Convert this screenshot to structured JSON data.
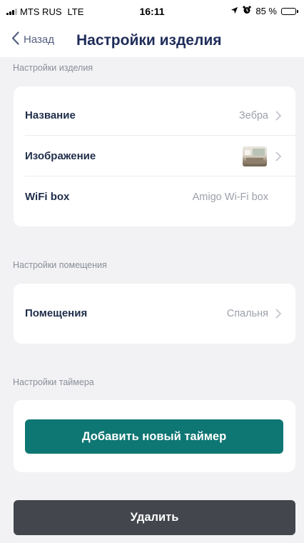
{
  "status_bar": {
    "carrier": "MTS RUS",
    "network": "LTE",
    "time": "16:11",
    "battery_percent": "85 %",
    "battery_level": 0.85,
    "icons": [
      "signal-icon",
      "location-arrow-icon",
      "alarm-icon",
      "battery-icon"
    ]
  },
  "nav": {
    "back_label": "Назад",
    "title": "Настройки изделия"
  },
  "product_section": {
    "header": "Настройки изделия",
    "rows": [
      {
        "label": "Название",
        "value": "Зебра"
      },
      {
        "label": "Изображение",
        "value": ""
      },
      {
        "label": "WiFi box",
        "value": "Amigo Wi-Fi box"
      }
    ]
  },
  "room_section": {
    "header": "Настройки помещения",
    "rows": [
      {
        "label": "Помещения",
        "value": "Спальня"
      }
    ]
  },
  "timer_section": {
    "header": "Настройки таймера",
    "add_timer_label": "Добавить новый таймер"
  },
  "delete_label": "Удалить",
  "colors": {
    "accent": "#0e7673",
    "title": "#1f2d5a",
    "delete": "#43464c",
    "background": "#f2f2f4"
  }
}
